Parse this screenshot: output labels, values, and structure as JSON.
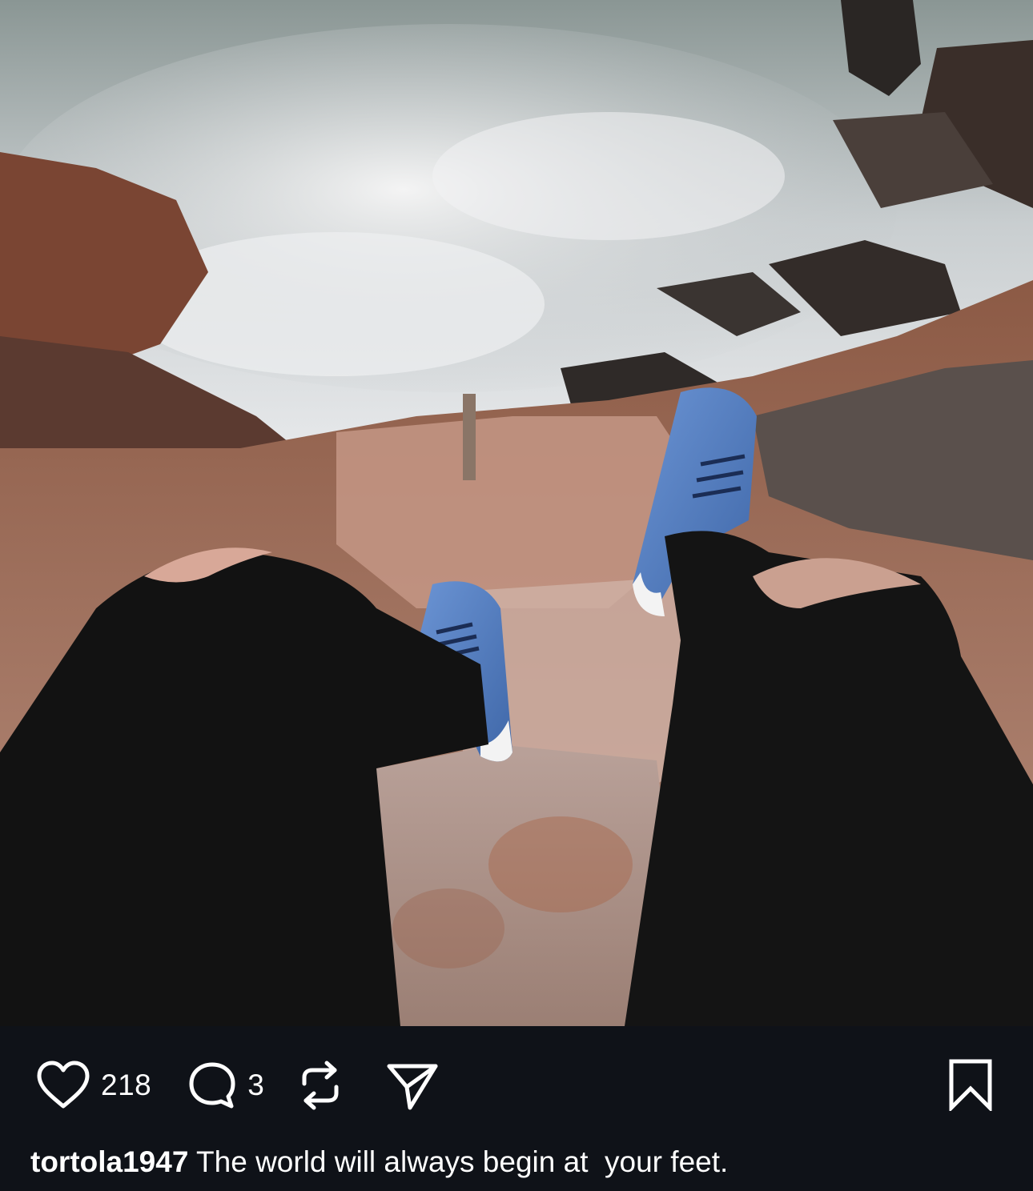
{
  "post": {
    "image_alt": "Legs in ripped black jeans and blue sneakers dangling over a rocky cliff above the sea",
    "actions": {
      "like_count": "218",
      "comment_count": "3"
    },
    "caption": {
      "username": "tortola1947",
      "text": " The world will always begin at  your feet."
    }
  },
  "icons": {
    "like": "heart-icon",
    "comment": "comment-bubble-icon",
    "repost": "repost-icon",
    "share": "send-icon",
    "bookmark": "bookmark-icon"
  },
  "colors": {
    "bar_background": "#0f1218",
    "text": "#ffffff",
    "sneakers": "#4f7bbd",
    "jeans": "#111111"
  }
}
